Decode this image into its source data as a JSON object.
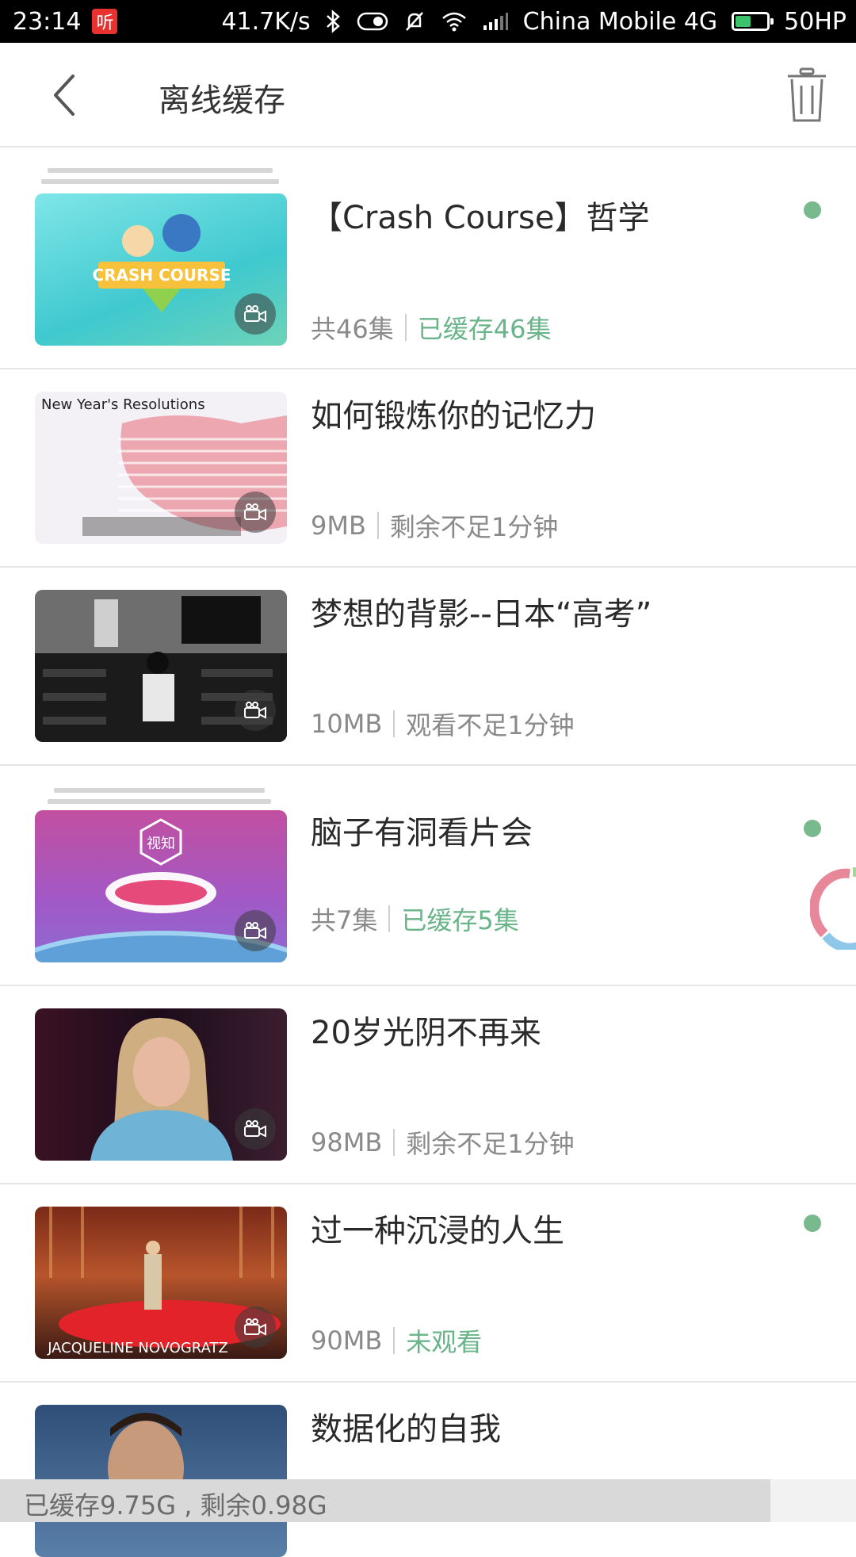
{
  "status_bar": {
    "time": "23:14",
    "ting_badge": "听",
    "net_speed": "41.7K/s",
    "carrier": "China Mobile 4G",
    "battery": "50HP",
    "battery_level": 0.5
  },
  "header": {
    "title": "离线缓存",
    "back_icon": "chevron-left-icon",
    "trash_icon": "trash-icon"
  },
  "items": [
    {
      "title": "【Crash Course】哲学",
      "meta_left": "共46集",
      "meta_right": "已缓存46集",
      "right_green": true,
      "dot": true,
      "stacked": true,
      "thumb_text": "CRASH COURSE"
    },
    {
      "title": "如何锻炼你的记忆力",
      "meta_left": "9MB",
      "meta_right": "剩余不足1分钟",
      "right_green": false,
      "dot": false,
      "stacked": false,
      "thumb_text": "New Year's Resolutions"
    },
    {
      "title": "梦想的背影--日本“高考”",
      "meta_left": "10MB",
      "meta_right": "观看不足1分钟",
      "right_green": false,
      "dot": false,
      "stacked": false,
      "thumb_text": ""
    },
    {
      "title": "脑子有洞看片会",
      "meta_left": "共7集",
      "meta_right": "已缓存5集",
      "right_green": true,
      "dot": true,
      "stacked": true,
      "thumb_text": "视知"
    },
    {
      "title": "20岁光阴不再来",
      "meta_left": "98MB",
      "meta_right": "剩余不足1分钟",
      "right_green": false,
      "dot": false,
      "stacked": false,
      "thumb_text": ""
    },
    {
      "title": "过一种沉浸的人生",
      "meta_left": "90MB",
      "meta_right": "未观看",
      "right_green": true,
      "dot": true,
      "stacked": false,
      "thumb_text": "JACQUELINE NOVOGRATZ"
    },
    {
      "title": "数据化的自我",
      "meta_left": "",
      "meta_right": "",
      "right_green": false,
      "dot": false,
      "stacked": false,
      "thumb_text": ""
    }
  ],
  "footer": {
    "storage_text": "已缓存9.75G , 剩余0.98G",
    "used_fraction": 0.9
  },
  "colors": {
    "accent_green": "#6ab489",
    "dot_green": "#79b98e",
    "divider": "#e6e6e6"
  }
}
